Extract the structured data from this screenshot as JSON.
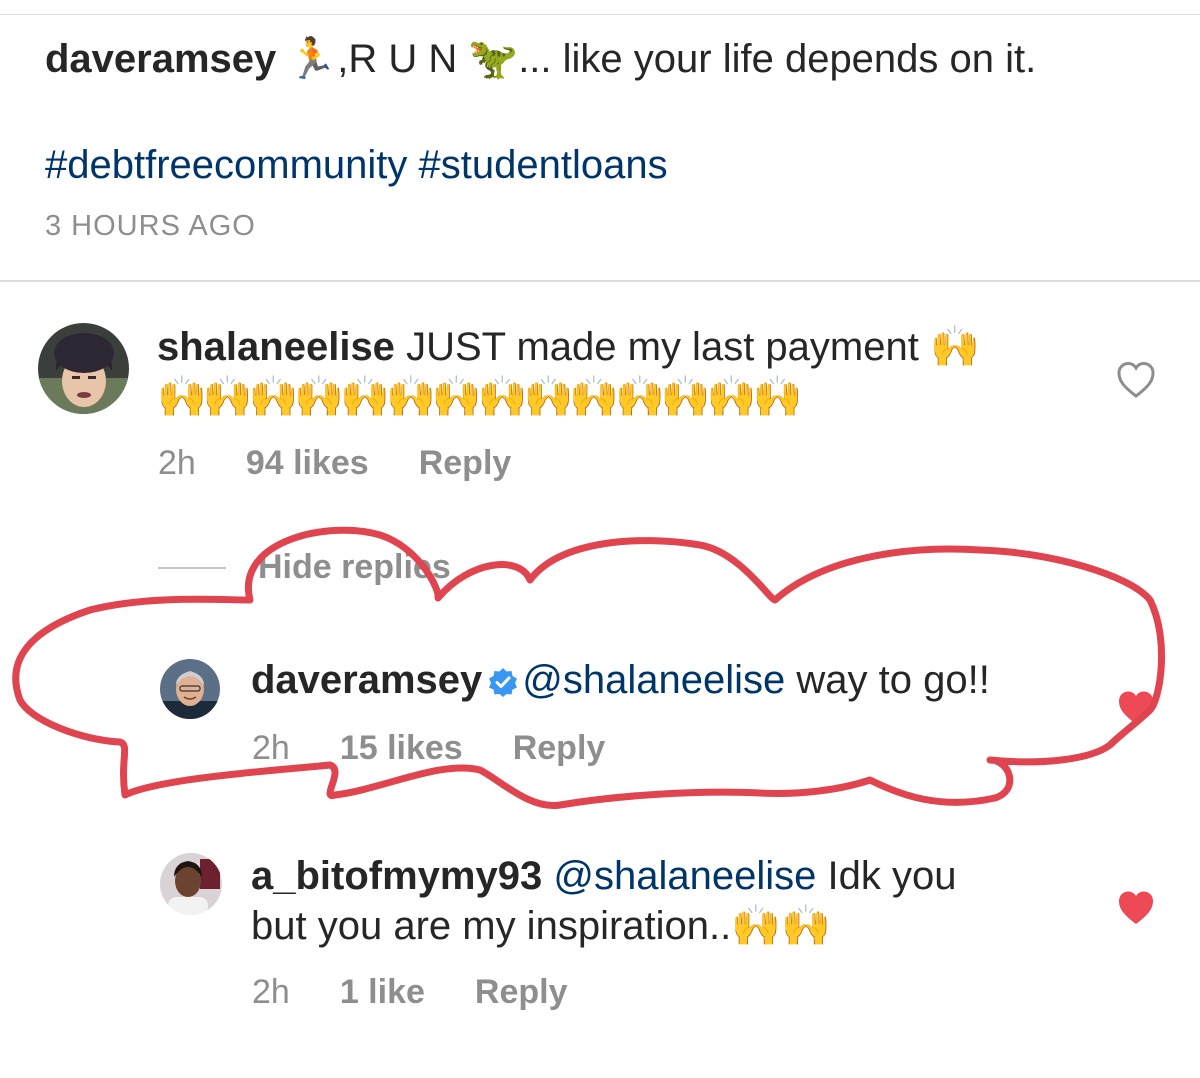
{
  "post": {
    "username": "daveramsey",
    "caption_part1": "R U N",
    "caption_part2": "... like your life depends on it.",
    "hashtags": "#debtfreecommunity #studentloans",
    "timestamp": "3 HOURS AGO",
    "runner_emoji": "🏃",
    "dino_emoji": "🦖"
  },
  "comments": [
    {
      "username": "shalaneelise",
      "text": "JUST made my last payment",
      "emoji_line1": "🙌",
      "emoji_line2": "🙌🙌🙌🙌🙌🙌🙌🙌🙌🙌🙌🙌🙌🙌",
      "time": "2h",
      "likes": "94 likes",
      "reply_label": "Reply",
      "liked": false,
      "avatar_icon": "user-avatar"
    }
  ],
  "hide_replies_label": "Hide replies",
  "replies": [
    {
      "username": "daveramsey",
      "verified": true,
      "verified_icon": "verified-badge-icon",
      "mention": "@shalaneelise",
      "text": "way to go!!",
      "time": "2h",
      "likes": "15 likes",
      "reply_label": "Reply",
      "liked": true
    },
    {
      "username": "a_bitofmymy93",
      "mention": "@shalaneelise",
      "text_line1": "Idk you",
      "text_line2": "but you are my inspiration..",
      "emoji": "🙌🙌",
      "time": "2h",
      "likes": "1 like",
      "reply_label": "Reply",
      "liked": true
    }
  ],
  "colors": {
    "text": "#262626",
    "meta": "#8e8e8e",
    "link": "#003569",
    "heart_liked": "#ed4956",
    "annotation": "#e0454f",
    "verified": "#3897f0"
  }
}
